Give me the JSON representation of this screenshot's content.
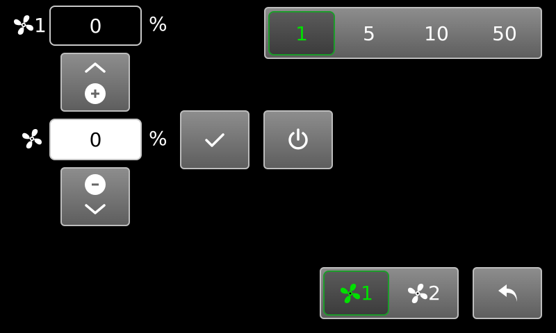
{
  "fan1": {
    "label": "1",
    "value": "0",
    "unit": "%"
  },
  "fan_selected": {
    "value": "0",
    "unit": "%"
  },
  "step_selector": {
    "options": [
      "1",
      "5",
      "10",
      "50"
    ],
    "selected": "1"
  },
  "fan_tabs": [
    {
      "label": "1",
      "active": true
    },
    {
      "label": "2",
      "active": false
    }
  ],
  "icons": {
    "fan": "fan-icon",
    "up": "chevron-up-icon",
    "down": "chevron-down-icon",
    "plus": "plus-circle-icon",
    "minus": "minus-circle-icon",
    "check": "check-icon",
    "power": "power-icon",
    "back": "undo-arrow-icon"
  },
  "colors": {
    "accent": "#00e000",
    "button_top": "#8d8d8d",
    "button_bottom": "#5e5e5e"
  }
}
